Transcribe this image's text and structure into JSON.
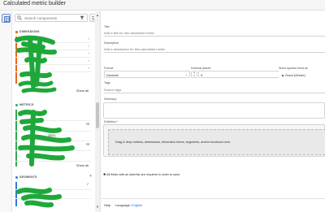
{
  "window": {
    "title": "Calculated metric builder"
  },
  "panel": {
    "search": {
      "placeholder": "Search components"
    },
    "sections": [
      {
        "label": "DIMENSIONS",
        "color": "#e8671c",
        "show_all": "Show all"
      },
      {
        "label": "METRICS",
        "color": "#36a852",
        "show_all": "Show all"
      },
      {
        "label": "SEGMENTS",
        "color": "#2f7bd8"
      }
    ],
    "metric_rows": [
      "",
      "",
      "SED)",
      "",
      ""
    ]
  },
  "form": {
    "title_label": "Title",
    "title_placeholder": "Add a title for this calculated metric",
    "description_label": "Description",
    "description_placeholder": "Add a description for this calculated metric",
    "format_label": "Format",
    "format_value": "Decimal",
    "decimal_label": "Decimal places",
    "decimal_value": "0",
    "upward_label": "Show upward trend as",
    "upward_value": "Good (Green)",
    "tags_label": "Tags",
    "tags_placeholder": "Search tags",
    "summary_label": "Summary",
    "definition_label": "Definition *",
    "drop_text": "Drag & drop metrics, dimensions, dimension items, segments, and/or functions here.",
    "note": "All fields with an asterisk are required in order to save."
  },
  "footer": {
    "help": "Help",
    "language_label": "Language:",
    "language_value": "English"
  },
  "colors": {
    "scribble": "#1fa83a"
  }
}
